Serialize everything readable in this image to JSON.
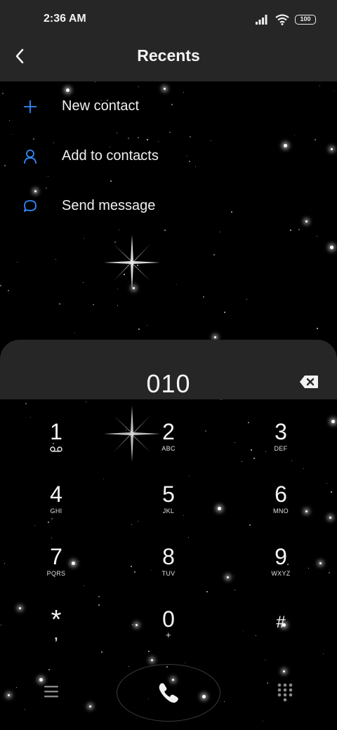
{
  "status_bar": {
    "time": "2:36 AM",
    "battery": "100"
  },
  "header": {
    "title": "Recents"
  },
  "actions": [
    {
      "label": "New contact",
      "icon": "plus-icon"
    },
    {
      "label": "Add to contacts",
      "icon": "person-icon"
    },
    {
      "label": "Send message",
      "icon": "message-bubble-icon"
    }
  ],
  "dialer": {
    "number": "010"
  },
  "keypad": [
    {
      "digit": "1",
      "letters": ""
    },
    {
      "digit": "2",
      "letters": "ABC"
    },
    {
      "digit": "3",
      "letters": "DEF"
    },
    {
      "digit": "4",
      "letters": "GHI"
    },
    {
      "digit": "5",
      "letters": "JKL"
    },
    {
      "digit": "6",
      "letters": "MNO"
    },
    {
      "digit": "7",
      "letters": "PQRS"
    },
    {
      "digit": "8",
      "letters": "TUV"
    },
    {
      "digit": "9",
      "letters": "WXYZ"
    },
    {
      "digit": "*",
      "letters": ","
    },
    {
      "digit": "0",
      "letters": "+"
    },
    {
      "digit": "#",
      "letters": ""
    }
  ],
  "colors": {
    "accent": "#2f8cff",
    "panel": "#262626",
    "background": "#000000"
  }
}
